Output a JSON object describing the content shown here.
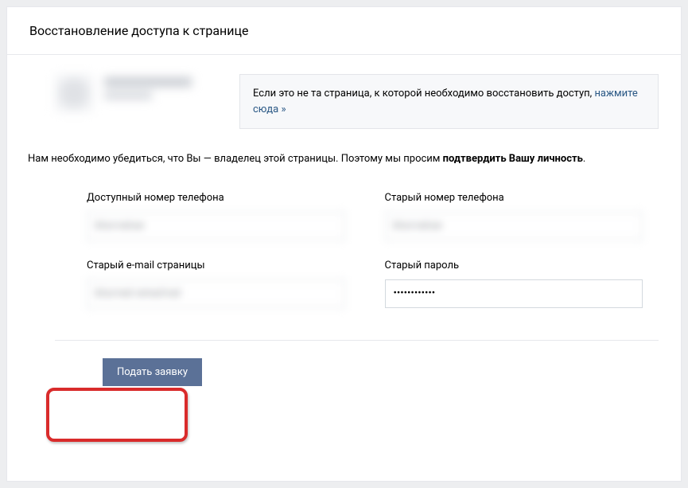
{
  "header": {
    "title": "Восстановление доступа к странице"
  },
  "info_box": {
    "text_before": "Если это не та страница, к которой необходимо восстановить доступ, ",
    "link_text": "нажмите сюда »"
  },
  "instruction": {
    "prefix": "Нам необходимо убедиться, что Вы — владелец этой страницы. Поэтому мы просим ",
    "bold": "подтвердить Вашу личность",
    "suffix": "."
  },
  "form": {
    "available_phone": {
      "label": "Доступный номер телефона",
      "value": "blurvalue"
    },
    "old_phone": {
      "label": "Старый номер телефона",
      "value": "blurvalue"
    },
    "old_email": {
      "label": "Старый e-mail страницы",
      "value": "blurred emailval"
    },
    "old_password": {
      "label": "Старый пароль",
      "value": "••••••••••••"
    }
  },
  "footer": {
    "submit_label": "Подать заявку"
  }
}
